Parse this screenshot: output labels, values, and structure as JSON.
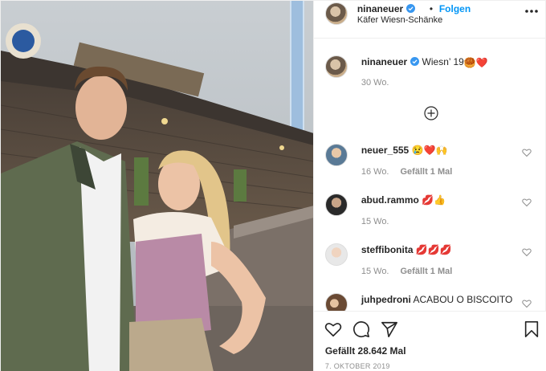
{
  "header": {
    "username": "ninaneuer",
    "separator": "•",
    "follow_label": "Folgen",
    "location": "Käfer Wiesn-Schänke",
    "more_icon": "more-horizontal-icon",
    "verified_icon": "verified-badge-icon"
  },
  "caption": {
    "username": "ninaneuer",
    "text": "Wiesn’ 19",
    "emojis": [
      "🥮",
      "❤️"
    ],
    "time": "30 Wo."
  },
  "load_more_icon": "plus-circle-icon",
  "comments": [
    {
      "username": "neuer_555",
      "text": "😢❤️🙌",
      "time": "16 Wo.",
      "likes": "Gefällt 1 Mal"
    },
    {
      "username": "abud.rammo",
      "text": "💋👍",
      "time": "15 Wo.",
      "likes": ""
    },
    {
      "username": "steffibonita",
      "text": "💋💋💋",
      "time": "15 Wo.",
      "likes": "Gefällt 1 Mal"
    },
    {
      "username": "juhpedroni",
      "text": "ACABOU O BISCOITO",
      "time": "",
      "likes": ""
    }
  ],
  "actions": {
    "like_icon": "heart-icon",
    "comment_icon": "comment-icon",
    "share_icon": "paper-plane-icon",
    "save_icon": "bookmark-icon"
  },
  "likes_text": "Gefällt 28.642 Mal",
  "date": "7. OKTOBER 2019",
  "colors": {
    "link_blue": "#0095f6",
    "verified_blue": "#3897f0",
    "text": "#262626",
    "muted": "#8e8e8e",
    "border": "#efefef"
  }
}
